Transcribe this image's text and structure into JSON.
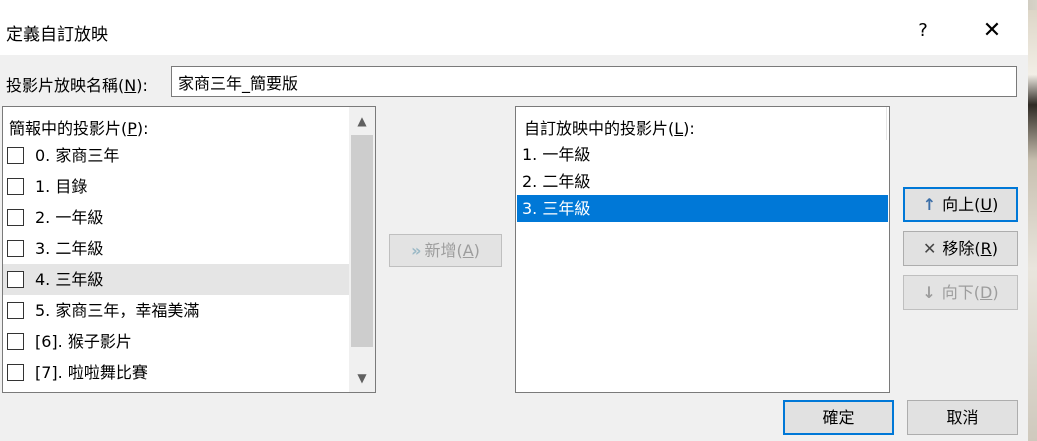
{
  "dialog": {
    "title": "定義自訂放映",
    "help_label": "?",
    "close_label": "✕"
  },
  "name_field": {
    "label_prefix": "投影片放映名稱(",
    "label_key": "N",
    "label_suffix": "):",
    "value": "家商三年_簡要版"
  },
  "left_list": {
    "header_prefix": "簡報中的投影片(",
    "header_key": "P",
    "header_suffix": "):",
    "items": [
      {
        "label": "0. 家商三年",
        "checked": false
      },
      {
        "label": "1.  目錄",
        "checked": false
      },
      {
        "label": "2. 一年級",
        "checked": false
      },
      {
        "label": "3. 二年級",
        "checked": false
      },
      {
        "label": "4. 三年級",
        "checked": false
      },
      {
        "label": "5. 家商三年，幸福美滿",
        "checked": false
      },
      {
        "label": "[6]. 猴子影片",
        "checked": false
      },
      {
        "label": "[7]. 啦啦舞比賽",
        "checked": false
      }
    ],
    "scroll_up_icon": "▲",
    "scroll_down_icon": "▼"
  },
  "add_button": {
    "prefix": "新增(",
    "key": "A",
    "suffix": ")",
    "icon": "»"
  },
  "right_list": {
    "header_prefix": "自訂放映中的投影片(",
    "header_key": "L",
    "header_suffix": "):",
    "items": [
      {
        "label": "1. 一年級"
      },
      {
        "label": "2. 二年級"
      },
      {
        "label": "3. 三年級"
      }
    ],
    "selected_index": 2
  },
  "side_buttons": {
    "up": {
      "prefix": "向上(",
      "key": "U",
      "suffix": ")",
      "icon": "↑"
    },
    "remove": {
      "prefix": "移除(",
      "key": "R",
      "suffix": ")",
      "icon": "✕"
    },
    "down": {
      "prefix": "向下(",
      "key": "D",
      "suffix": ")",
      "icon": "↓"
    }
  },
  "footer": {
    "ok_label": "確定",
    "cancel_label": "取消"
  },
  "colors": {
    "accent": "#0078d7",
    "selection": "#0078d7",
    "dialog_bg": "#f0f0f0"
  }
}
